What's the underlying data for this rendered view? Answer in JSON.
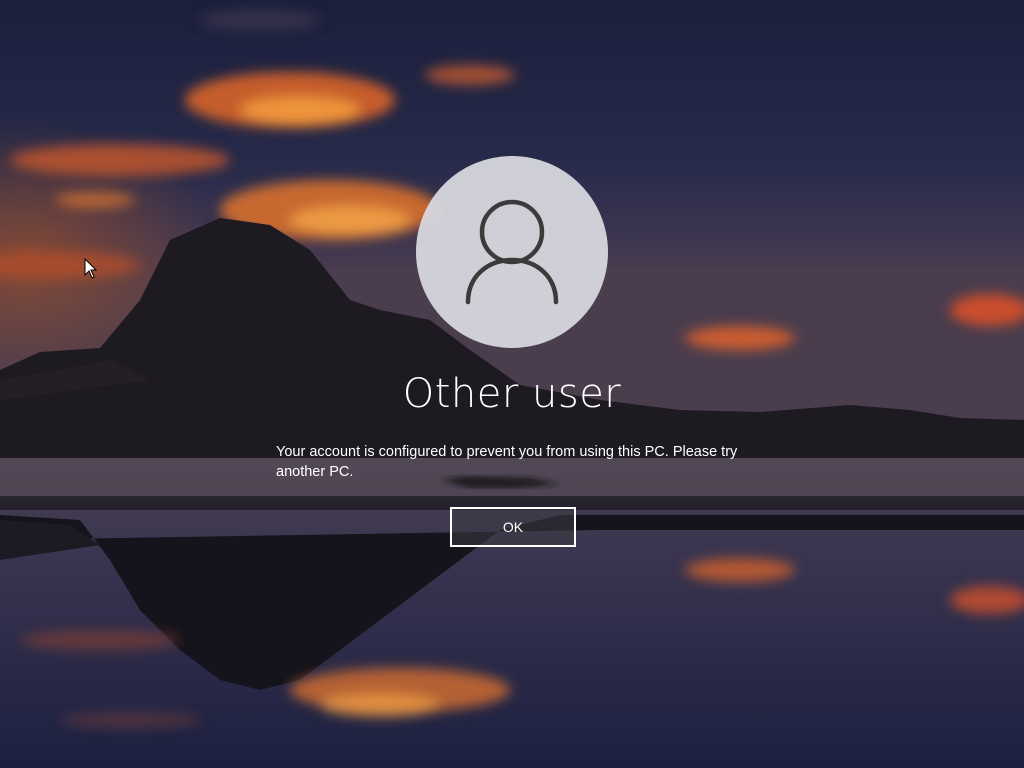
{
  "lock_screen": {
    "background": "sunset-lake-mountain-wallpaper",
    "avatar_icon": "user-silhouette-icon",
    "user_name": "Other user",
    "message": "Your account is configured to prevent you from using this PC. Please try another PC.",
    "ok_label": "OK"
  },
  "colors": {
    "sky_dark": "#1d2240",
    "cloud_orange": "#e0662a",
    "avatar_bg": "#dadae2",
    "icon_stroke": "#3b3b3b",
    "text": "#ffffff"
  },
  "cursor": "mouse-pointer-icon"
}
